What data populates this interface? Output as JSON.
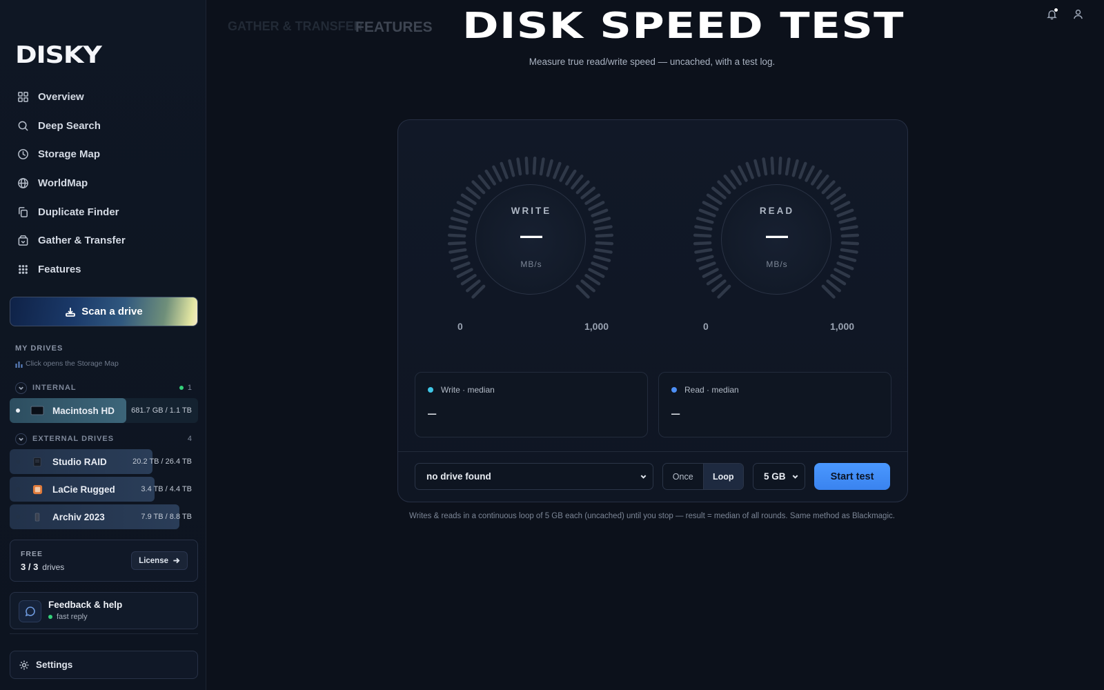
{
  "app": {
    "logo": "DISKY"
  },
  "sidebar": {
    "nav": [
      {
        "label": "Overview",
        "icon": "grid-icon"
      },
      {
        "label": "Deep Search",
        "icon": "search-icon"
      },
      {
        "label": "Storage Map",
        "icon": "pie-chart-icon"
      },
      {
        "label": "WorldMap",
        "icon": "globe-icon"
      },
      {
        "label": "Duplicate Finder",
        "icon": "copy-icon"
      },
      {
        "label": "Gather & Transfer",
        "icon": "archive-icon"
      },
      {
        "label": "Features",
        "icon": "apps-icon"
      }
    ],
    "scan_label": "Scan a drive",
    "my_drives_title": "MY DRIVES",
    "my_drives_hint": "Click opens the Storage Map",
    "internal": {
      "title": "INTERNAL",
      "count": "1",
      "drives": [
        {
          "name": "Macintosh HD",
          "size": "681.7 GB / 1.1 TB",
          "used_fraction": 0.62
        }
      ]
    },
    "external": {
      "title": "EXTERNAL DRIVES",
      "count": "4",
      "drives": [
        {
          "name": "Studio RAID",
          "size": "20.2 TB / 26.4 TB",
          "used_fraction": 0.76
        },
        {
          "name": "LaCie Rugged",
          "size": "3.4 TB / 4.4 TB",
          "used_fraction": 0.77
        },
        {
          "name": "Archiv 2023",
          "size": "7.9 TB / 8.8 TB",
          "used_fraction": 0.9
        }
      ]
    },
    "plan": {
      "tier": "FREE",
      "used": "3 / 3",
      "unit": "drives",
      "license_label": "License"
    },
    "help": {
      "title": "Feedback & help",
      "subtitle": "fast reply"
    },
    "settings_label": "Settings"
  },
  "header": {
    "ghost_tab_1": "GATHER & TRANSFER",
    "ghost_tab_2": "FEATURES",
    "title": "DISK SPEED TEST",
    "subtitle": "Measure true read/write speed — uncached, with a test log."
  },
  "gauges": {
    "write": {
      "label": "WRITE",
      "value": "—",
      "unit": "MB/s",
      "min": "0",
      "max": "1,000"
    },
    "read": {
      "label": "READ",
      "value": "—",
      "unit": "MB/s",
      "min": "0",
      "max": "1,000"
    }
  },
  "stats": {
    "write": {
      "label": "Write · median",
      "value": "–",
      "color": "#3fc6e6"
    },
    "read": {
      "label": "Read · median",
      "value": "–",
      "color": "#4d8ff5"
    }
  },
  "controls": {
    "drive_select": "no drive found",
    "mode_once": "Once",
    "mode_loop": "Loop",
    "mode_selected": "Loop",
    "size_select": "5 GB",
    "start_label": "Start test"
  },
  "footnote": "Writes & reads in a continuous loop of 5 GB each (uncached) until you stop — result = median of all rounds. Same method as Blackmagic.",
  "colors": {
    "accent": "#3a83ef",
    "background": "#0c111b"
  }
}
